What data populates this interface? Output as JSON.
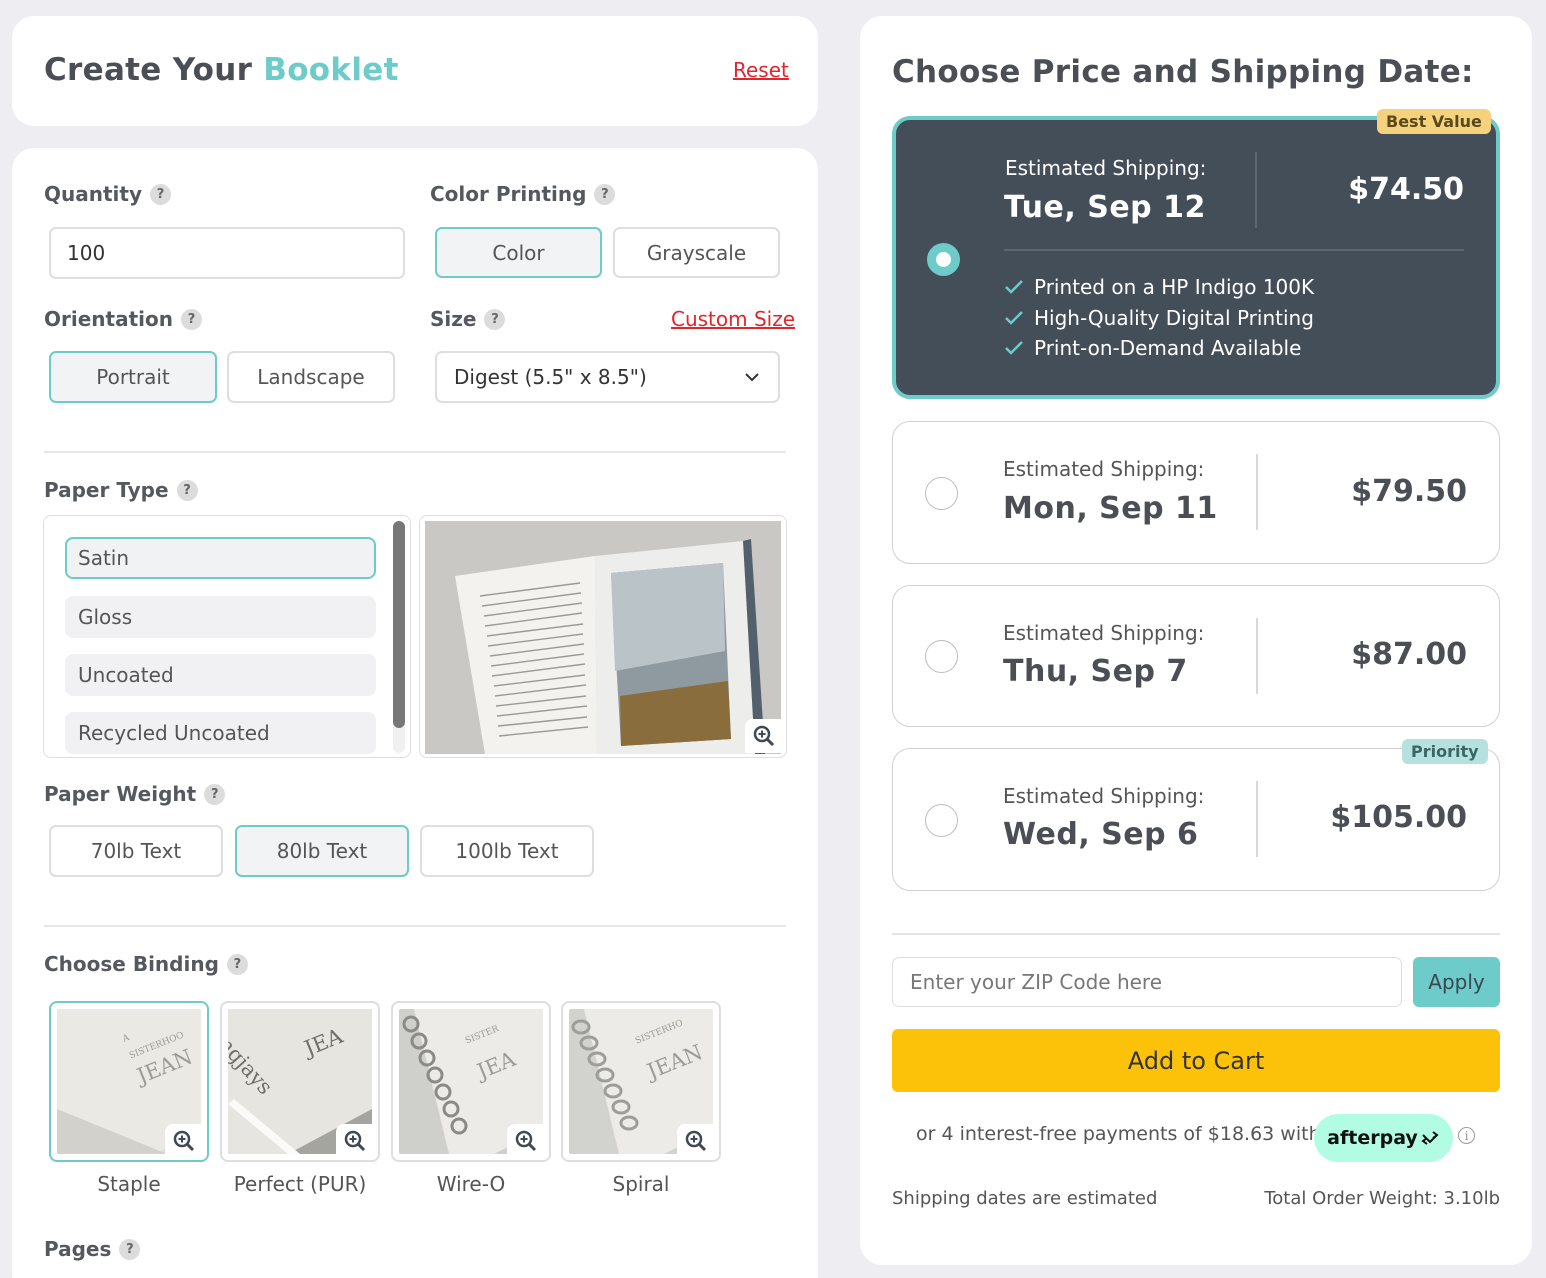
{
  "header": {
    "title_prefix": "Create Your",
    "title_accent": "Booklet",
    "reset_label": "Reset"
  },
  "form": {
    "quantity": {
      "label": "Quantity",
      "value": "100"
    },
    "color_printing": {
      "label": "Color Printing",
      "options": [
        "Color",
        "Grayscale"
      ],
      "selected": "Color"
    },
    "orientation": {
      "label": "Orientation",
      "options": [
        "Portrait",
        "Landscape"
      ],
      "selected": "Portrait"
    },
    "size": {
      "label": "Size",
      "custom_label": "Custom Size",
      "value": "Digest (5.5\" x 8.5\")"
    },
    "paper_type": {
      "label": "Paper Type",
      "options": [
        "Satin",
        "Gloss",
        "Uncoated",
        "Recycled Uncoated"
      ],
      "selected": "Satin"
    },
    "paper_weight": {
      "label": "Paper Weight",
      "options": [
        "70lb Text",
        "80lb Text",
        "100lb Text"
      ],
      "selected": "80lb Text"
    },
    "binding": {
      "label": "Choose Binding",
      "options": [
        "Staple",
        "Perfect (PUR)",
        "Wire-O",
        "Spiral"
      ],
      "selected": "Staple"
    },
    "pages": {
      "label": "Pages"
    },
    "help_glyph": "?"
  },
  "pricing": {
    "title": "Choose Price and Shipping Date:",
    "est_label": "Estimated Shipping:",
    "options": [
      {
        "date": "Tue, Sep 12",
        "price": "$74.50",
        "badge": "Best Value",
        "selected": true
      },
      {
        "date": "Mon, Sep 11",
        "price": "$79.50"
      },
      {
        "date": "Thu, Sep 7",
        "price": "$87.00"
      },
      {
        "date": "Wed, Sep 6",
        "price": "$105.00",
        "badge": "Priority"
      }
    ],
    "features": [
      "Printed on a HP Indigo 100K",
      "High-Quality Digital Printing",
      "Print-on-Demand Available"
    ],
    "zip_placeholder": "Enter your ZIP Code here",
    "apply_label": "Apply",
    "add_to_cart_label": "Add to Cart",
    "afterpay_text": "or 4 interest-free payments of $18.63 with",
    "afterpay_brand": "afterpay",
    "shipping_note": "Shipping dates are estimated",
    "total_weight": "Total Order Weight: 3.10lb"
  },
  "colors": {
    "accent": "#6dcbc9",
    "selected_card": "#444e59",
    "cart_button": "#fcc20a",
    "link_red": "#e0262d",
    "best_value_badge": "#f5d27e",
    "priority_badge": "#b5e1df",
    "afterpay_pill": "#b2fce4"
  },
  "icons": [
    "help-icon",
    "zoom-in-icon",
    "chevron-down-icon",
    "check-icon",
    "info-icon",
    "afterpay-logo-icon"
  ]
}
